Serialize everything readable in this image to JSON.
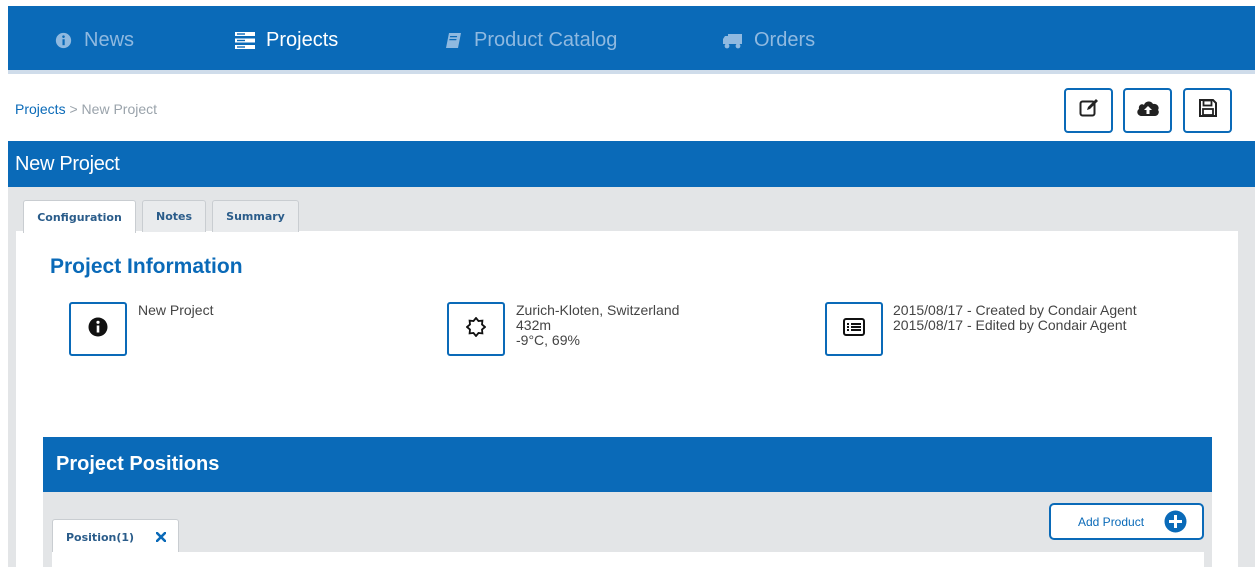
{
  "nav": {
    "items": [
      {
        "label": "News",
        "icon": "info-circle-icon",
        "active": false
      },
      {
        "label": "Projects",
        "icon": "server-icon",
        "active": true
      },
      {
        "label": "Product Catalog",
        "icon": "book-icon",
        "active": false
      },
      {
        "label": "Orders",
        "icon": "truck-icon",
        "active": false
      }
    ]
  },
  "breadcrumb": {
    "root": "Projects",
    "separator": ">",
    "current": "New Project"
  },
  "toolbar": {
    "buttons": [
      "edit-icon",
      "cloud-upload-icon",
      "save-icon"
    ]
  },
  "panel": {
    "title": "New Project"
  },
  "tabs": [
    {
      "label": "Configuration",
      "active": true
    },
    {
      "label": "Notes",
      "active": false
    },
    {
      "label": "Summary",
      "active": false
    }
  ],
  "project_info": {
    "title": "Project Information",
    "name": "New Project",
    "location": {
      "place": "Zurich-Kloten, Switzerland",
      "altitude": "432m",
      "climate": "-9°C, 69%"
    },
    "history": {
      "created": "2015/08/17 - Created by Condair Agent",
      "edited": "2015/08/17 - Edited by Condair Agent"
    }
  },
  "positions": {
    "title": "Project Positions",
    "tab_label": "Position(1)",
    "add_button": "Add Product"
  },
  "colors": {
    "primary": "#0a6ab8",
    "nav_dim": "#8fb9e0",
    "tab_bg": "#e3e5e7"
  }
}
